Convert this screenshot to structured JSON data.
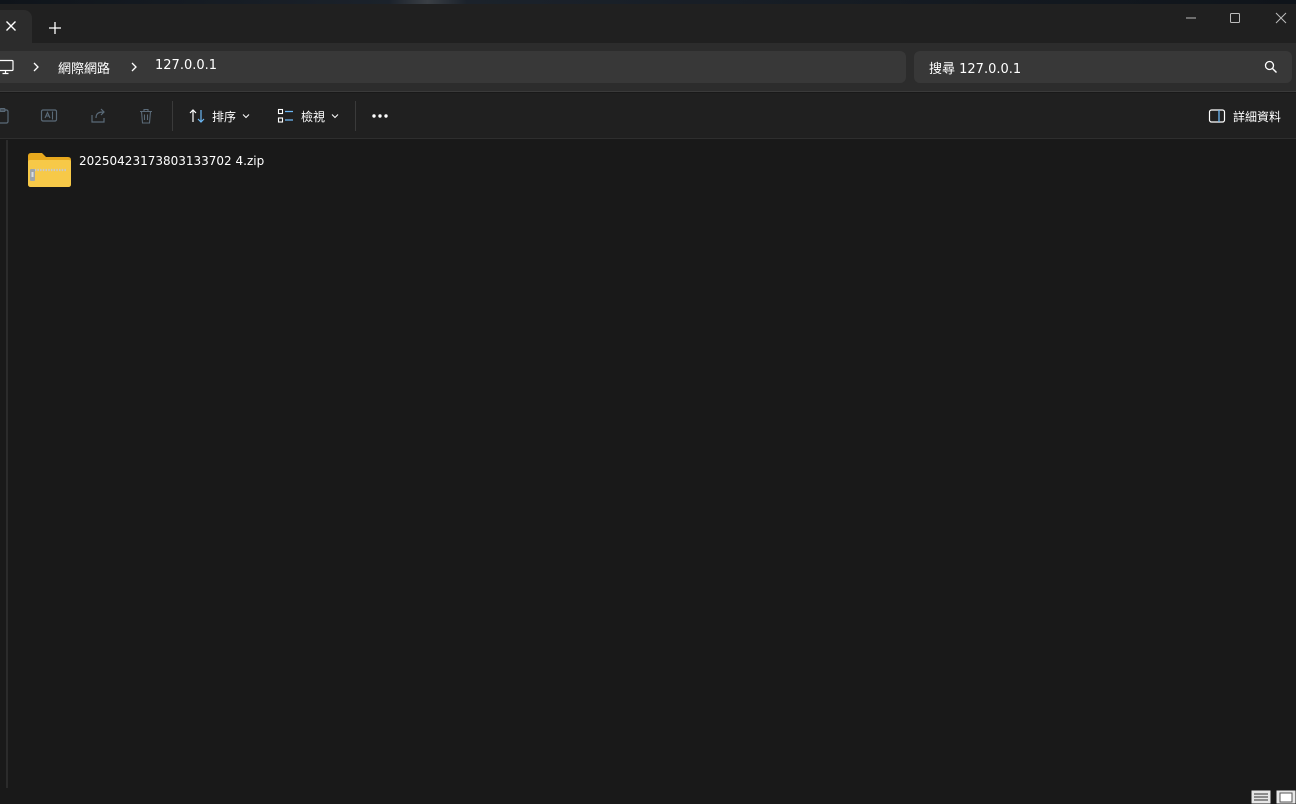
{
  "tab": {
    "close_icon": "close-icon"
  },
  "titlebar": {
    "new_tab_icon": "plus-icon"
  },
  "window_controls": [
    "minimize-icon",
    "maximize-icon",
    "close-icon"
  ],
  "breadcrumb": {
    "root_icon": "computer-icon",
    "items": [
      "網際網路",
      "127.0.0.1"
    ]
  },
  "search": {
    "placeholder": "搜尋 127.0.0.1"
  },
  "toolbar": {
    "sort_label": "排序",
    "view_label": "檢視",
    "details_label": "詳細資料"
  },
  "files": [
    {
      "name": "20250423173803133702 4.zip",
      "type": "zip-folder"
    }
  ],
  "colors": {
    "background": "#191919",
    "toolbar": "#202020",
    "address": "#2c2c2c",
    "folder": "#f7c948",
    "accent": "#6cb8f5"
  }
}
